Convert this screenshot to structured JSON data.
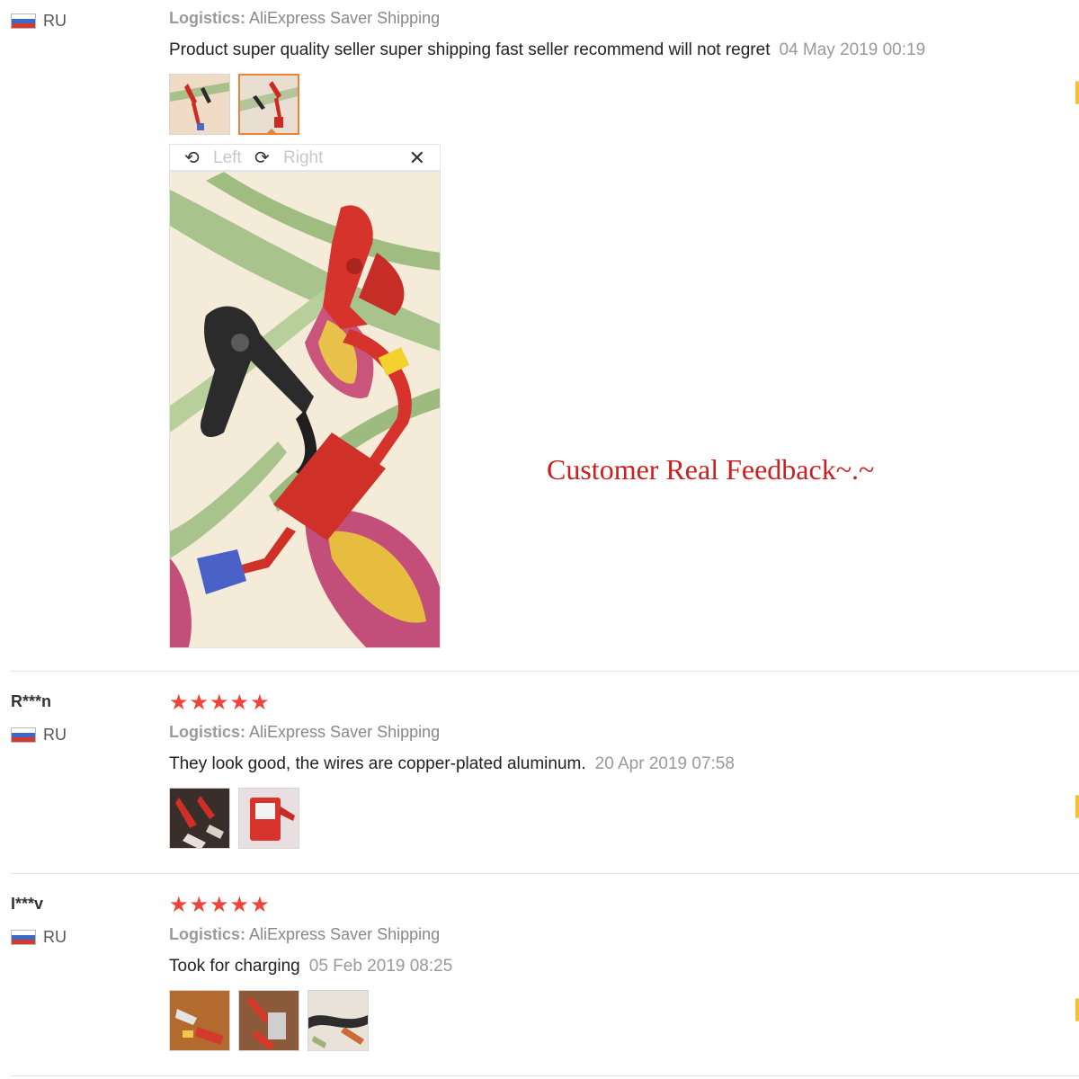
{
  "reviews": [
    {
      "user": "",
      "country": "RU",
      "logistics_label": "Logistics:",
      "logistics_value": "AliExpress Saver Shipping",
      "text": "Product super quality seller super shipping fast seller recommend will not regret",
      "date": "04 May 2019 00:19",
      "photos": [
        "clamps-photo-1",
        "clamps-photo-2"
      ]
    },
    {
      "user": "R***n",
      "country": "RU",
      "stars": "★★★★★",
      "rating": 5,
      "logistics_label": "Logistics:",
      "logistics_value": "AliExpress Saver Shipping",
      "text": "They look good, the wires are copper-plated aluminum.",
      "date": "20 Apr 2019 07:58",
      "photos": [
        "clamps-photo-3",
        "clamps-photo-4"
      ]
    },
    {
      "user": "I***v",
      "country": "RU",
      "stars": "★★★★★",
      "rating": 5,
      "logistics_label": "Logistics:",
      "logistics_value": "AliExpress Saver Shipping",
      "text": "Took for charging",
      "date": "05 Feb 2019 08:25",
      "photos": [
        "clamps-photo-5",
        "clamps-photo-6",
        "clamps-photo-7"
      ]
    }
  ],
  "viewer": {
    "rotate_left_label": "Left",
    "rotate_right_label": "Right",
    "close_icon": "close-icon"
  },
  "headline": "Customer Real Feedback~.~",
  "colors": {
    "star": "#f0433a",
    "headline": "#cc1f1f",
    "active_thumb_border": "#e8833a",
    "divider": "#e4e4e4"
  }
}
